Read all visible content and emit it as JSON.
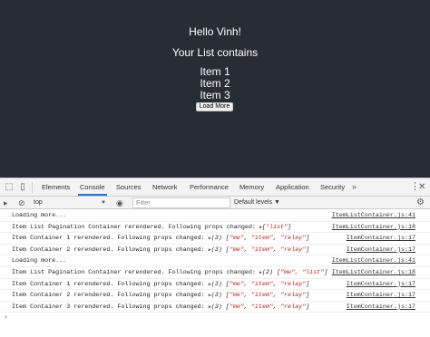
{
  "app": {
    "greeting": "Hello Vinh!",
    "list_heading": "Your List contains",
    "items": [
      "Item 1",
      "Item 2",
      "Item 3"
    ],
    "load_more_label": "Load More"
  },
  "devtools": {
    "tabs": [
      "Elements",
      "Console",
      "Sources",
      "Network",
      "Performance",
      "Memory",
      "Application",
      "Security"
    ],
    "active_tab": "Console",
    "more_tabs_label": "»",
    "toolbar": {
      "context": "top",
      "filter_placeholder": "Filter",
      "levels": "Default levels ▼"
    },
    "console_rows": [
      {
        "prefix": "Loading more...",
        "arr": "",
        "items": [],
        "source": "ItemListContainer.js:41"
      },
      {
        "prefix": "Item List Pagination Container rerendered. Following props changed: ",
        "arr": "",
        "items": [
          "\"list\""
        ],
        "source": "ItemListContainer.js:18"
      },
      {
        "prefix": "Item Container 1 rerendered. Following props changed: ",
        "arr": "(3) ",
        "items": [
          "\"me\"",
          "\"item\"",
          "\"relay\""
        ],
        "source": "ItemContainer.js:17"
      },
      {
        "prefix": "Item Container 2 rerendered. Following props changed: ",
        "arr": "(3) ",
        "items": [
          "\"me\"",
          "\"item\"",
          "\"relay\""
        ],
        "source": "ItemContainer.js:17"
      },
      {
        "prefix": "Loading more...",
        "arr": "",
        "items": [],
        "source": "ItemListContainer.js:41"
      },
      {
        "prefix": "Item List Pagination Container rerendered. Following props changed: ",
        "arr": "(2) ",
        "items": [
          "\"me\"",
          "\"list\""
        ],
        "source": "ItemListContainer.js:18"
      },
      {
        "prefix": "Item Container 1 rerendered. Following props changed: ",
        "arr": "(3) ",
        "items": [
          "\"me\"",
          "\"item\"",
          "\"relay\""
        ],
        "source": "ItemContainer.js:17"
      },
      {
        "prefix": "Item Container 2 rerendered. Following props changed: ",
        "arr": "(3) ",
        "items": [
          "\"me\"",
          "\"item\"",
          "\"relay\""
        ],
        "source": "ItemContainer.js:17"
      },
      {
        "prefix": "Item Container 3 rerendered. Following props changed: ",
        "arr": "(3) ",
        "items": [
          "\"me\"",
          "\"item\"",
          "\"relay\""
        ],
        "source": "ItemContainer.js:17"
      }
    ],
    "prompt_symbol": "›"
  },
  "colors": {
    "app_background": "#282c34",
    "string_token": "#c41a16",
    "active_tab_underline": "#1a73e8"
  }
}
